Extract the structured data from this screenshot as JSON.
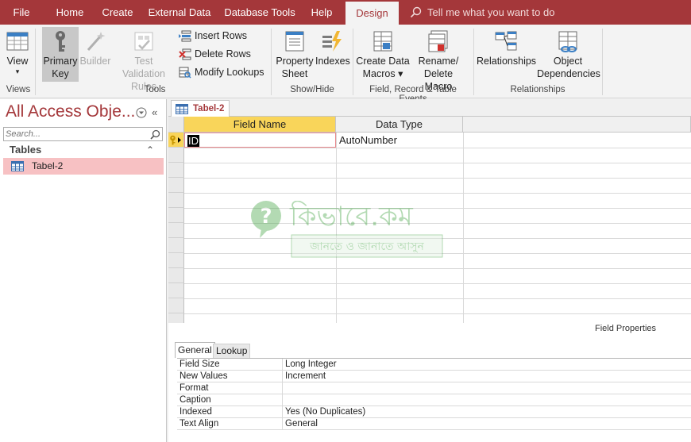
{
  "menu": {
    "tabs": [
      "File",
      "Home",
      "Create",
      "External Data",
      "Database Tools",
      "Help",
      "Design"
    ],
    "active_tab": "Design",
    "tell_me": "Tell me what you want to do"
  },
  "ribbon": {
    "view": {
      "label": "View",
      "arrow": "▾"
    },
    "primary_key": {
      "line1": "Primary",
      "line2": "Key"
    },
    "builder": {
      "label": "Builder"
    },
    "test_validation": {
      "line1": "Test Validation",
      "line2": "Rules"
    },
    "insert_rows": "Insert Rows",
    "delete_rows": "Delete Rows",
    "modify_lookups": "Modify Lookups",
    "property_sheet": {
      "line1": "Property",
      "line2": "Sheet"
    },
    "indexes": {
      "label": "Indexes"
    },
    "create_data_macros": {
      "line1": "Create Data",
      "line2": "Macros ▾"
    },
    "rename_delete_macro": {
      "line1": "Rename/",
      "line2": "Delete Macro"
    },
    "relationships": {
      "label": "Relationships"
    },
    "object_dependencies": {
      "line1": "Object",
      "line2": "Dependencies"
    },
    "groups": {
      "views": "Views",
      "tools": "Tools",
      "show_hide": "Show/Hide",
      "field_record_table_events": "Field, Record & Table Events",
      "relationships": "Relationships"
    }
  },
  "nav": {
    "title": "All Access Obje...",
    "collapse_icon": "«",
    "search_placeholder": "Search...",
    "group": "Tables",
    "group_toggle": "⌃",
    "items": [
      {
        "label": "Tabel-2"
      }
    ]
  },
  "document": {
    "tab": "Tabel-2",
    "columns": [
      "Field Name",
      "Data Type"
    ],
    "rows": [
      {
        "field_name": "ID",
        "data_type": "AutoNumber",
        "primary_key": true
      }
    ],
    "field_properties_title": "Field Properties",
    "property_tabs": [
      "General",
      "Lookup"
    ],
    "properties": [
      {
        "name": "Field Size",
        "value": "Long Integer"
      },
      {
        "name": "New Values",
        "value": "Increment"
      },
      {
        "name": "Format",
        "value": ""
      },
      {
        "name": "Caption",
        "value": ""
      },
      {
        "name": "Indexed",
        "value": "Yes (No Duplicates)"
      },
      {
        "name": "Text Align",
        "value": "General"
      }
    ]
  },
  "watermark": {
    "text1": "কিভাবে.কম",
    "text2": "জানতে ও জানাতে আসুন"
  },
  "colors": {
    "accent": "#a4373a",
    "selection": "#f7c1c3",
    "header_highlight": "#f9d55a"
  }
}
